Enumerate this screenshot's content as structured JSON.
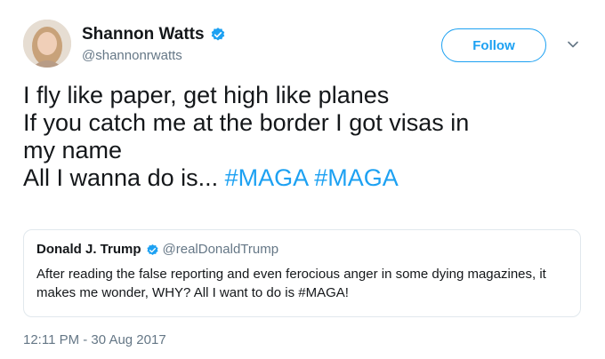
{
  "author": {
    "name": "Shannon Watts",
    "handle": "@shannonrwatts",
    "avatar_icon": "profile-photo"
  },
  "actions": {
    "follow_label": "Follow",
    "menu_icon": "chevron-down-icon"
  },
  "tweet": {
    "lines": [
      "I fly like paper, get high like planes",
      "If you catch me at the border I got visas in",
      "my name"
    ],
    "last_line_text": "All I wanna do is... ",
    "hashtags": [
      "#MAGA",
      "#MAGA"
    ]
  },
  "quoted_tweet": {
    "name": "Donald J. Trump",
    "handle": "@realDonaldTrump",
    "text": "After reading the false reporting and even ferocious anger in some dying magazines, it makes me wonder, WHY? All I want to do is #MAGA!"
  },
  "timestamp": "12:11 PM - 30 Aug 2017",
  "colors": {
    "accent": "#1da1f2",
    "secondary_text": "#657786",
    "border": "#e1e8ed"
  }
}
